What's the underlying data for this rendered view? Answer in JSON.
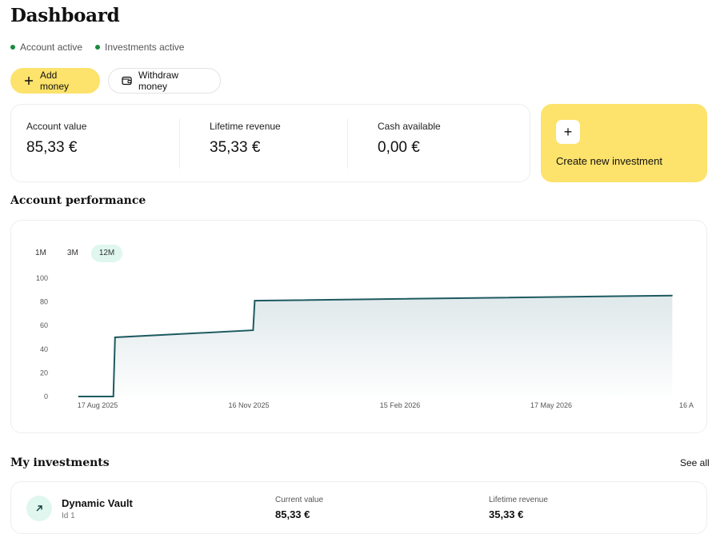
{
  "header": {
    "title": "Dashboard"
  },
  "status": [
    {
      "label": "Account active",
      "color": "#1a8a3f"
    },
    {
      "label": "Investments active",
      "color": "#1a8a3f"
    }
  ],
  "actions": {
    "add_money": "Add money",
    "withdraw_money": "Withdraw money"
  },
  "stats": [
    {
      "label": "Account value",
      "value": "85,33 €"
    },
    {
      "label": "Lifetime revenue",
      "value": "35,33 €"
    },
    {
      "label": "Cash available",
      "value": "0,00 €"
    }
  ],
  "create_card": {
    "label": "Create new investment",
    "plus": "+"
  },
  "performance": {
    "title": "Account performance",
    "ranges": [
      "1M",
      "3M",
      "12M"
    ],
    "selected_range": "12M"
  },
  "chart_data": {
    "type": "area",
    "x": [
      "2025-08-17",
      "2025-09-07",
      "2025-09-08",
      "2025-11-30",
      "2025-12-01",
      "2026-08-09"
    ],
    "values": [
      0,
      0,
      50,
      56,
      81,
      85.33
    ],
    "xticks": [
      "17 Aug 2025",
      "16 Nov 2025",
      "15 Feb 2026",
      "17 May 2026",
      "16 A"
    ],
    "yticks": [
      0,
      20,
      40,
      60,
      80,
      100
    ],
    "ylim": [
      0,
      100
    ],
    "line_color": "#1d5a60",
    "fill_color": "#dfe8ea",
    "grid": false
  },
  "investments": {
    "title": "My investments",
    "see_all": "See all",
    "items": [
      {
        "name": "Dynamic Vault",
        "id": "Id 1",
        "current_value_label": "Current value",
        "current_value": "85,33 €",
        "lifetime_revenue_label": "Lifetime revenue",
        "lifetime_revenue": "35,33 €"
      }
    ]
  },
  "colors": {
    "accent": "#fde26b",
    "mint": "#dff7ef"
  }
}
